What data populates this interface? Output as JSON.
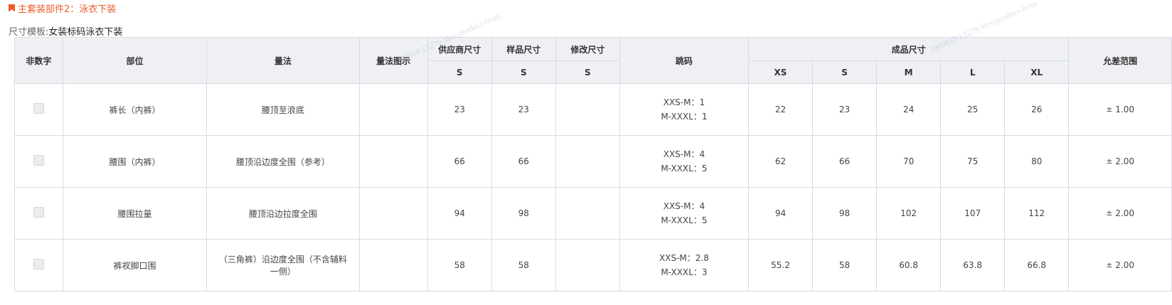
{
  "section": {
    "title": "主套装部件2：泳衣下装"
  },
  "template": {
    "label": "尺寸模板:",
    "value": "女装标码泳衣下装"
  },
  "table": {
    "headers": {
      "non_numeric": "非数字",
      "part": "部位",
      "method": "量法",
      "method_image": "量法图示",
      "supplier_size": "供应商尺寸",
      "sample_size": "样品尺寸",
      "modified_size": "修改尺寸",
      "jump_code": "跳码",
      "finished_size": "成品尺寸",
      "tolerance": "允差范围"
    },
    "sub_headers": {
      "supplier": "S",
      "sample": "S",
      "modified": "S",
      "finished": [
        "XS",
        "S",
        "M",
        "L",
        "XL"
      ]
    },
    "rows": [
      {
        "part": "裤长（内裤）",
        "method": "腰顶至浪底",
        "supplier": "23",
        "sample": "23",
        "modified": "",
        "jump": [
          "XXS-M：1",
          "M-XXXL：1"
        ],
        "finished": [
          "22",
          "23",
          "24",
          "25",
          "26"
        ],
        "tol_sign": "±",
        "tol": "1.00"
      },
      {
        "part": "腰围（内裤）",
        "method": "腰顶沿边度全围（参考）",
        "supplier": "66",
        "sample": "66",
        "modified": "",
        "jump": [
          "XXS-M：4",
          "M-XXXL：5"
        ],
        "finished": [
          "62",
          "66",
          "70",
          "75",
          "80"
        ],
        "tol_sign": "±",
        "tol": "2.00"
      },
      {
        "part": "腰围拉量",
        "method": "腰顶沿边拉度全围",
        "supplier": "94",
        "sample": "98",
        "modified": "",
        "jump": [
          "XXS-M：4",
          "M-XXXL：5"
        ],
        "finished": [
          "94",
          "98",
          "102",
          "107",
          "112"
        ],
        "tol_sign": "±",
        "tol": "2.00"
      },
      {
        "part": "裤衩脚口围",
        "method": "（三角裤）沿边度全围（不含辅料一侧）",
        "supplier": "58",
        "sample": "58",
        "modified": "",
        "jump": [
          "XXS-M：2.8",
          "M-XXXL：3"
        ],
        "finished": [
          "55.2",
          "58",
          "60.8",
          "63.8",
          "66.8"
        ],
        "tol_sign": "±",
        "tol": "2.00"
      }
    ]
  },
  "watermark": {
    "text": "2000810 13279 /des-product-front"
  }
}
